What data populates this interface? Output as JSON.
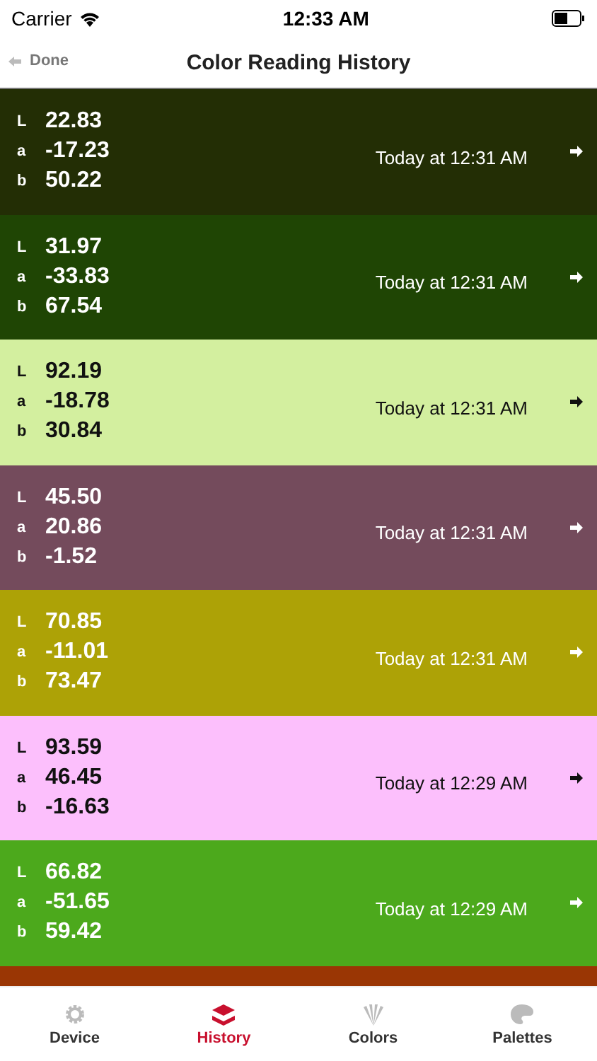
{
  "status_bar": {
    "carrier": "Carrier",
    "time": "12:33 AM"
  },
  "nav": {
    "back": "Done",
    "title": "Color Reading History"
  },
  "readings": [
    {
      "kind": "light",
      "color": "#232e05",
      "values": [
        {
          "label": "L",
          "value": "22.83"
        },
        {
          "label": "a",
          "value": "-17.23"
        },
        {
          "label": "b",
          "value": "50.22"
        }
      ],
      "time": "Today at 12:31 AM"
    },
    {
      "kind": "light",
      "color": "#1f4504",
      "values": [
        {
          "label": "L",
          "value": "31.97"
        },
        {
          "label": "a",
          "value": "-33.83"
        },
        {
          "label": "b",
          "value": "67.54"
        }
      ],
      "time": "Today at 12:31 AM"
    },
    {
      "kind": "dark",
      "color": "#d3ef9f",
      "values": [
        {
          "label": "L",
          "value": "92.19"
        },
        {
          "label": "a",
          "value": "-18.78"
        },
        {
          "label": "b",
          "value": "30.84"
        }
      ],
      "time": "Today at 12:31 AM"
    },
    {
      "kind": "light",
      "color": "#744b5c",
      "values": [
        {
          "label": "L",
          "value": "45.50"
        },
        {
          "label": "a",
          "value": "20.86"
        },
        {
          "label": "b",
          "value": "-1.52"
        }
      ],
      "time": "Today at 12:31 AM"
    },
    {
      "kind": "light",
      "color": "#ada206",
      "values": [
        {
          "label": "L",
          "value": "70.85"
        },
        {
          "label": "a",
          "value": "-11.01"
        },
        {
          "label": "b",
          "value": "73.47"
        }
      ],
      "time": "Today at 12:31 AM"
    },
    {
      "kind": "dark",
      "color": "#fcbffc",
      "values": [
        {
          "label": "L",
          "value": "93.59"
        },
        {
          "label": "a",
          "value": "46.45"
        },
        {
          "label": "b",
          "value": "-16.63"
        }
      ],
      "time": "Today at 12:29 AM"
    },
    {
      "kind": "light",
      "color": "#4ca91c",
      "values": [
        {
          "label": "L",
          "value": "66.82"
        },
        {
          "label": "a",
          "value": "-51.65"
        },
        {
          "label": "b",
          "value": "59.42"
        }
      ],
      "time": "Today at 12:29 AM"
    },
    {
      "kind": "cut",
      "color": "#9a3604"
    }
  ],
  "tabs": [
    {
      "label": "Device",
      "selected": false
    },
    {
      "label": "History",
      "selected": true
    },
    {
      "label": "Colors",
      "selected": false
    },
    {
      "label": "Palettes",
      "selected": false
    }
  ]
}
